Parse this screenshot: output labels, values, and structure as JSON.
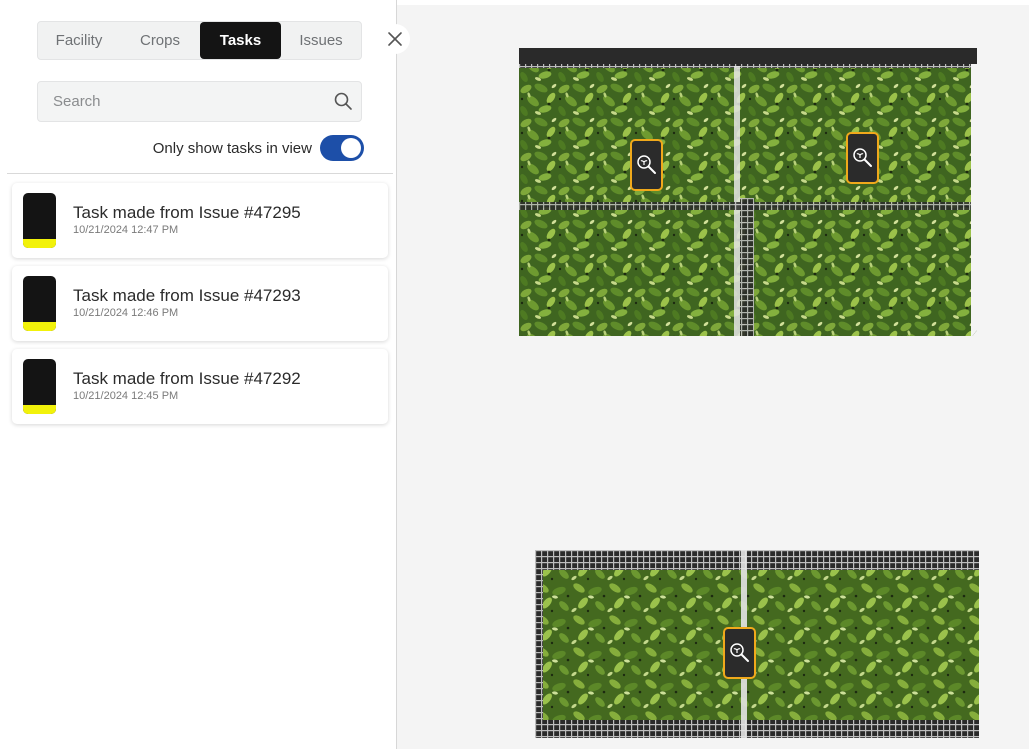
{
  "tabs": [
    {
      "label": "Facility",
      "active": false
    },
    {
      "label": "Crops",
      "active": false
    },
    {
      "label": "Tasks",
      "active": true
    },
    {
      "label": "Issues",
      "active": false
    }
  ],
  "search": {
    "placeholder": "Search",
    "value": ""
  },
  "filter": {
    "label": "Only show tasks in view",
    "enabled": true
  },
  "tasks": [
    {
      "title": "Task made from Issue #47295",
      "timestamp": "10/21/2024 12:47 PM"
    },
    {
      "title": "Task made from Issue #47293",
      "timestamp": "10/21/2024 12:46 PM"
    },
    {
      "title": "Task made from Issue #47292",
      "timestamp": "10/21/2024 12:45 PM"
    }
  ],
  "icons": {
    "close": "close-icon",
    "search": "search-icon",
    "marker": "plant-inspect-icon"
  },
  "colors": {
    "active_tab": "#141414",
    "toggle_on": "#1d4fa8",
    "task_stripe": "#f2f20a",
    "marker_border": "#f0a91b"
  }
}
